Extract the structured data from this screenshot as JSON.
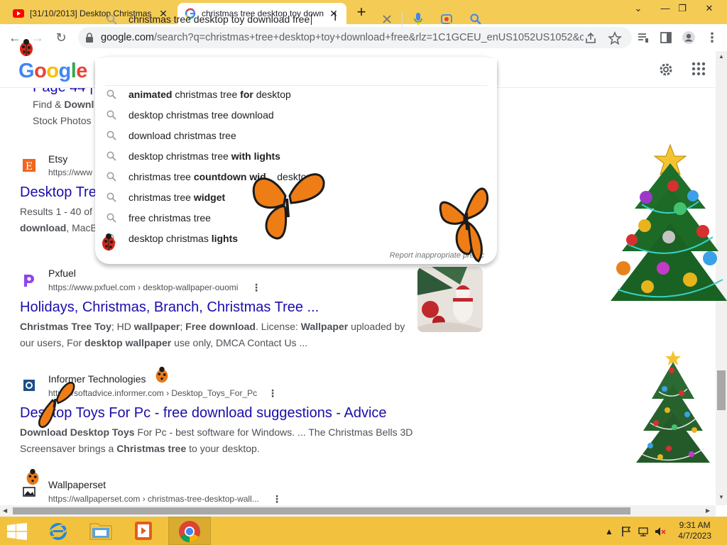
{
  "browser": {
    "tabs": [
      {
        "title": "[31/10/2013] Desktop Christmas",
        "favicon": "youtube-icon",
        "active": false
      },
      {
        "title": "christmas tree desktop toy down",
        "favicon": "google-icon",
        "active": true
      }
    ],
    "url_host": "google.com",
    "url_rest": "/search?q=christmas+tree+desktop+toy+download+free&rlz=1C1GCEU_enUS1052US1052&o..."
  },
  "google": {
    "logo": "Google",
    "query": "christmas tree desktop toy download free"
  },
  "suggestions": [
    {
      "pre": "",
      "bold": "animated",
      "mid": " christmas tree ",
      "bold2": "for",
      "post": " desktop"
    },
    {
      "pre": "desktop christmas tree download",
      "bold": "",
      "mid": "",
      "bold2": "",
      "post": ""
    },
    {
      "pre": "download christmas tree",
      "bold": "",
      "mid": "",
      "bold2": "",
      "post": ""
    },
    {
      "pre": "desktop christmas tree ",
      "bold": "with lights",
      "mid": "",
      "bold2": "",
      "post": ""
    },
    {
      "pre": "christmas tree ",
      "bold": "countdown wid",
      "mid": "",
      "bold2": "",
      "post": "    desktop"
    },
    {
      "pre": "christmas tree ",
      "bold": "widget",
      "mid": "",
      "bold2": "",
      "post": ""
    },
    {
      "pre": "free christmas tree",
      "bold": "",
      "mid": "",
      "bold2": "",
      "post": ""
    },
    {
      "pre": "desktop christmas ",
      "bold": "lights",
      "mid": "",
      "bold2": "",
      "post": ""
    }
  ],
  "report_text": "Report inappropriate predic",
  "partial_result": {
    "title": "Page 44 |",
    "line1_a": "Find & ",
    "line1_b": "Downl",
    "line2": "Stock Photos"
  },
  "results": [
    {
      "site": "Etsy",
      "url": "https://www",
      "title": "Desktop Tre",
      "snippet_a": "Results 1 - 40 of",
      "snippet_b": "download",
      "snippet_c": ", MacB"
    },
    {
      "site": "Pxfuel",
      "url": "https://www.pxfuel.com › desktop-wallpaper-ouomi",
      "title": "Holidays, Christmas, Branch, Christmas Tree ...",
      "snippet_html": [
        [
          "Christmas Tree Toy",
          true
        ],
        [
          "; HD ",
          false
        ],
        [
          "wallpaper",
          true
        ],
        [
          "; ",
          false
        ],
        [
          "Free download",
          true
        ],
        [
          ". License: ",
          false
        ],
        [
          "Wallpaper",
          true
        ],
        [
          " uploaded by",
          false
        ]
      ],
      "snippet_line2_a": "our users, For ",
      "snippet_line2_b": "desktop wallpaper",
      "snippet_line2_c": " use only, DMCA Contact Us ..."
    },
    {
      "site": "Informer Technologies",
      "url": "https://softadvice.informer.com › Desktop_Toys_For_Pc",
      "title": "Desktop Toys For Pc - free download suggestions - Advice",
      "snippet_line1": [
        [
          "Download Desktop Toys",
          true
        ],
        [
          " For Pc - best software for Windows. ... The Christmas Bells 3D",
          false
        ]
      ],
      "snippet_line2": [
        [
          "Screensaver brings a ",
          false
        ],
        [
          "Christmas tree",
          true
        ],
        [
          " to your desktop.",
          false
        ]
      ]
    },
    {
      "site": "Wallpaperset",
      "url": "https://wallpaperset.com › christmas-tree-desktop-wall..."
    }
  ],
  "taskbar": {
    "time": "9:31 AM",
    "date": "4/7/2023"
  },
  "colors": {
    "tabstrip": "#f4cb55",
    "taskbar": "#f2c23f",
    "link": "#1a0dab"
  }
}
